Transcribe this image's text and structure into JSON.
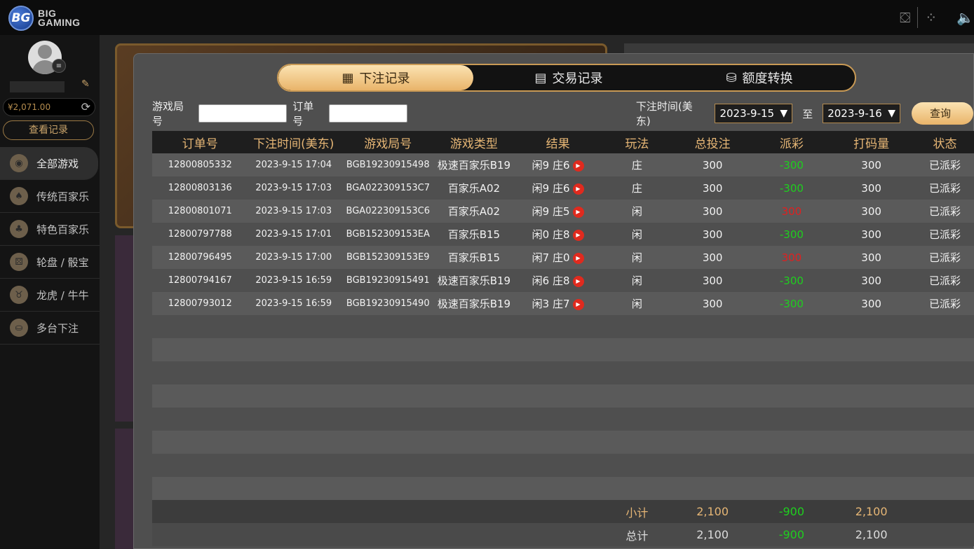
{
  "brand": {
    "logo_mark": "BG",
    "logo_text": "BIG GAMING"
  },
  "topbar": {
    "icons": [
      "gr-icon",
      "dots-icon",
      "speaker-icon"
    ]
  },
  "sidebar": {
    "balance": "¥2,071.00",
    "records_button": "查看记录",
    "nav": [
      {
        "label": "全部游戏",
        "icon": "chip-icon"
      },
      {
        "label": "传统百家乐",
        "icon": "cards-icon"
      },
      {
        "label": "特色百家乐",
        "icon": "cards2-icon"
      },
      {
        "label": "轮盘 / 骰宝",
        "icon": "roulette-icon"
      },
      {
        "label": "龙虎 / 牛牛",
        "icon": "bull-icon"
      },
      {
        "label": "多台下注",
        "icon": "chips-stack-icon"
      }
    ]
  },
  "modal": {
    "tabs": [
      "下注记录",
      "交易记录",
      "额度转换"
    ],
    "filters": {
      "round_label": "游戏局号",
      "order_label": "订单号",
      "time_label": "下注时间(美东)",
      "date_from": "2023-9-15",
      "to_label": "至",
      "date_to": "2023-9-16",
      "query_button": "查询"
    },
    "table": {
      "headers": [
        "订单号",
        "下注时间(美东)",
        "游戏局号",
        "游戏类型",
        "结果",
        "玩法",
        "总投注",
        "派彩",
        "打码量",
        "状态"
      ],
      "rows": [
        {
          "order": "12800805332",
          "time": "2023-9-15 17:04",
          "round": "BGB19230915498",
          "game": "极速百家乐B19",
          "result": "闲9 庄6",
          "play": "庄",
          "bet": "300",
          "payout": "-300",
          "payout_sign": "pos",
          "rolling": "300",
          "status": "已派彩"
        },
        {
          "order": "12800803136",
          "time": "2023-9-15 17:03",
          "round": "BGA022309153C7",
          "game": "百家乐A02",
          "result": "闲9 庄6",
          "play": "庄",
          "bet": "300",
          "payout": "-300",
          "payout_sign": "pos",
          "rolling": "300",
          "status": "已派彩"
        },
        {
          "order": "12800801071",
          "time": "2023-9-15 17:03",
          "round": "BGA022309153C6",
          "game": "百家乐A02",
          "result": "闲9 庄5",
          "play": "闲",
          "bet": "300",
          "payout": "300",
          "payout_sign": "neg",
          "rolling": "300",
          "status": "已派彩"
        },
        {
          "order": "12800797788",
          "time": "2023-9-15 17:01",
          "round": "BGB152309153EA",
          "game": "百家乐B15",
          "result": "闲0 庄8",
          "play": "闲",
          "bet": "300",
          "payout": "-300",
          "payout_sign": "pos",
          "rolling": "300",
          "status": "已派彩"
        },
        {
          "order": "12800796495",
          "time": "2023-9-15 17:00",
          "round": "BGB152309153E9",
          "game": "百家乐B15",
          "result": "闲7 庄0",
          "play": "闲",
          "bet": "300",
          "payout": "300",
          "payout_sign": "neg",
          "rolling": "300",
          "status": "已派彩"
        },
        {
          "order": "12800794167",
          "time": "2023-9-15 16:59",
          "round": "BGB19230915491",
          "game": "极速百家乐B19",
          "result": "闲6 庄8",
          "play": "闲",
          "bet": "300",
          "payout": "-300",
          "payout_sign": "pos",
          "rolling": "300",
          "status": "已派彩"
        },
        {
          "order": "12800793012",
          "time": "2023-9-15 16:59",
          "round": "BGB19230915490",
          "game": "极速百家乐B19",
          "result": "闲3 庄7",
          "play": "闲",
          "bet": "300",
          "payout": "-300",
          "payout_sign": "pos",
          "rolling": "300",
          "status": "已派彩"
        }
      ],
      "empty_rows": 8,
      "subtotal": {
        "label": "小计",
        "bet": "2,100",
        "payout": "-900",
        "rolling": "2,100"
      },
      "total": {
        "label": "总计",
        "bet": "2,100",
        "payout": "-900",
        "rolling": "2,100"
      }
    }
  },
  "colors": {
    "accent": "#e9b46a",
    "win": "#1ecf1e",
    "loss": "#e02020"
  }
}
